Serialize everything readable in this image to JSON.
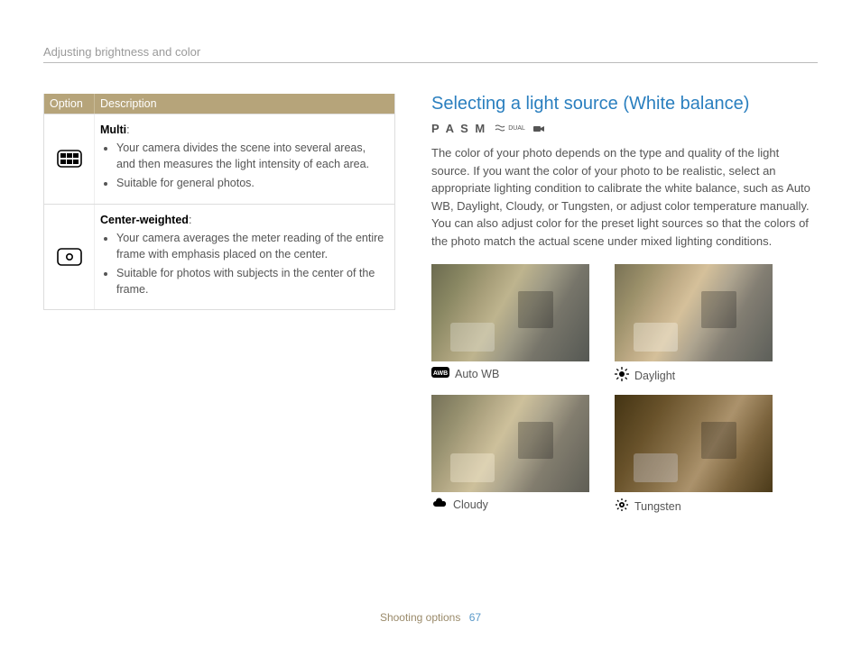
{
  "section_title": "Adjusting brightness and color",
  "table": {
    "headers": {
      "option": "Option",
      "description": "Description"
    },
    "rows": [
      {
        "icon": "metering-multi-icon",
        "name": "Multi",
        "bullets": [
          "Your camera divides the scene into several areas, and then measures the light intensity of each area.",
          "Suitable for general photos."
        ]
      },
      {
        "icon": "metering-center-icon",
        "name": "Center-weighted",
        "bullets": [
          "Your camera averages the meter reading of the entire frame with emphasis placed on the center.",
          "Suitable for photos with subjects in the center of the frame."
        ]
      }
    ]
  },
  "right": {
    "heading": "Selecting a light source (White balance)",
    "modes": "P A S M",
    "mode_extra": [
      "dual-icon",
      "movie-icon"
    ],
    "body": "The color of your photo depends on the type and quality of the light source. If you want the color of your photo to be realistic, select an appropriate lighting condition to calibrate the white balance, such as Auto WB, Daylight, Cloudy, or Tungsten, or adjust color temperature manually. You can also adjust color for the preset light sources so that the colors of the photo match the actual scene under mixed lighting conditions.",
    "samples": [
      {
        "icon": "awb-icon",
        "label": "Auto WB",
        "tint": "auto"
      },
      {
        "icon": "sun-icon",
        "label": "Daylight",
        "tint": "daylight"
      },
      {
        "icon": "cloud-icon",
        "label": "Cloudy",
        "tint": "cloudy"
      },
      {
        "icon": "bulb-icon",
        "label": "Tungsten",
        "tint": "tungsten"
      }
    ]
  },
  "footer": {
    "chapter": "Shooting options",
    "page": "67"
  }
}
